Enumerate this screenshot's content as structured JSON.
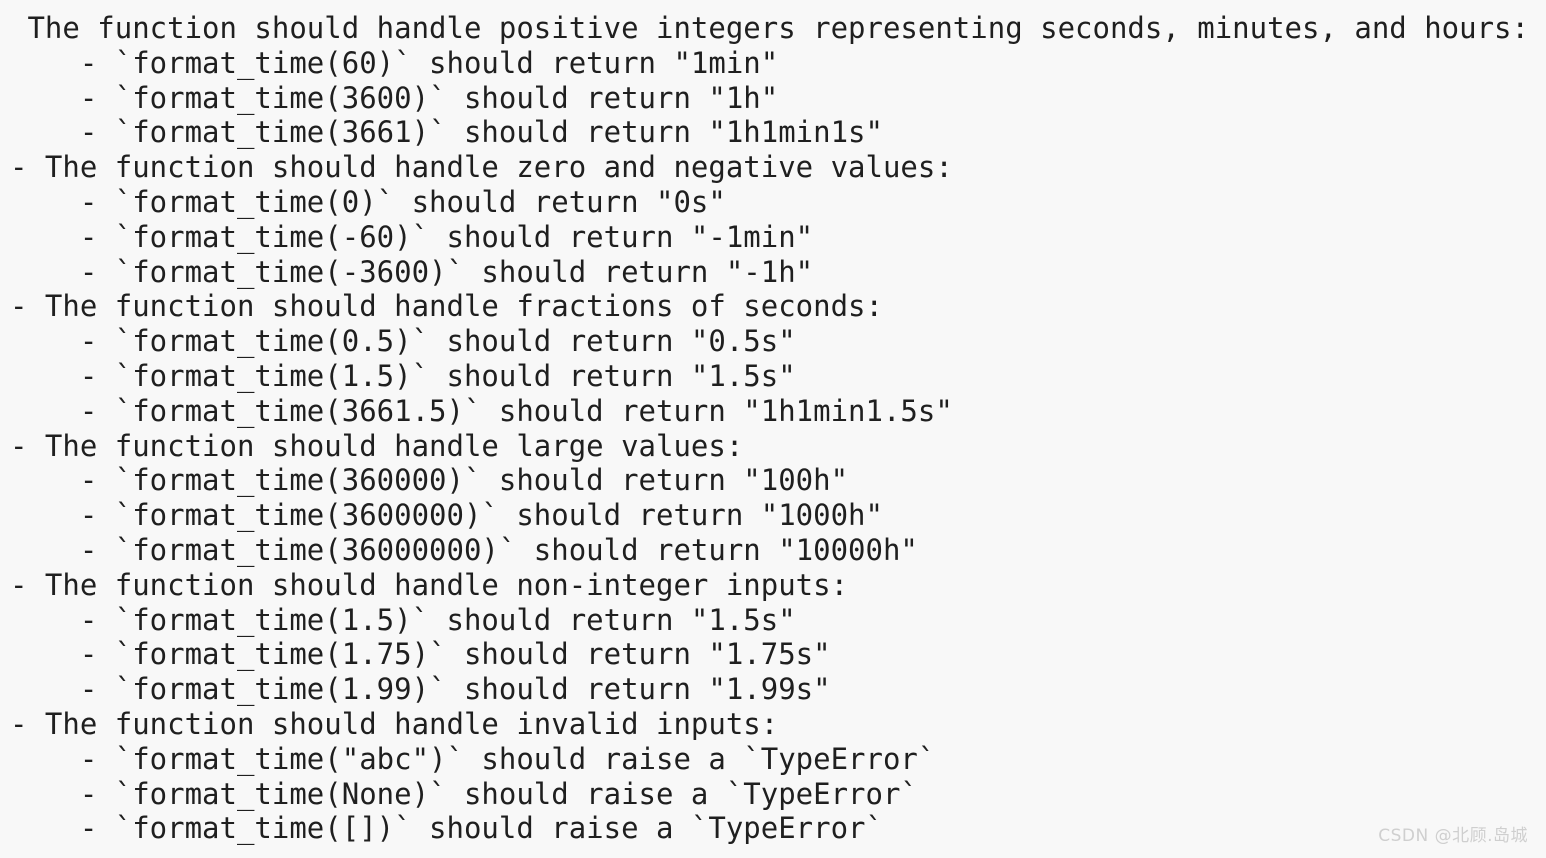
{
  "document": {
    "kind": "plain-text-spec-list",
    "background_color": "#f8f8f8",
    "text_color": "#1f1f1f",
    "lines": [
      " The function should handle positive integers representing seconds, minutes, and hours:",
      "    - `format_time(60)` should return \"1min\"",
      "    - `format_time(3600)` should return \"1h\"",
      "    - `format_time(3661)` should return \"1h1min1s\"",
      "- The function should handle zero and negative values:",
      "    - `format_time(0)` should return \"0s\"",
      "    - `format_time(-60)` should return \"-1min\"",
      "    - `format_time(-3600)` should return \"-1h\"",
      "- The function should handle fractions of seconds:",
      "    - `format_time(0.5)` should return \"0.5s\"",
      "    - `format_time(1.5)` should return \"1.5s\"",
      "    - `format_time(3661.5)` should return \"1h1min1.5s\"",
      "- The function should handle large values:",
      "    - `format_time(360000)` should return \"100h\"",
      "    - `format_time(3600000)` should return \"1000h\"",
      "    - `format_time(36000000)` should return \"10000h\"",
      "- The function should handle non-integer inputs:",
      "    - `format_time(1.5)` should return \"1.5s\"",
      "    - `format_time(1.75)` should return \"1.75s\"",
      "    - `format_time(1.99)` should return \"1.99s\"",
      "- The function should handle invalid inputs:",
      "    - `format_time(\"abc\")` should raise a `TypeError`",
      "    - `format_time(None)` should raise a `TypeError`",
      "    - `format_time([])` should raise a `TypeError`"
    ]
  },
  "watermark": {
    "text": "CSDN @北顾.岛城",
    "color": "#cfcfcf"
  }
}
